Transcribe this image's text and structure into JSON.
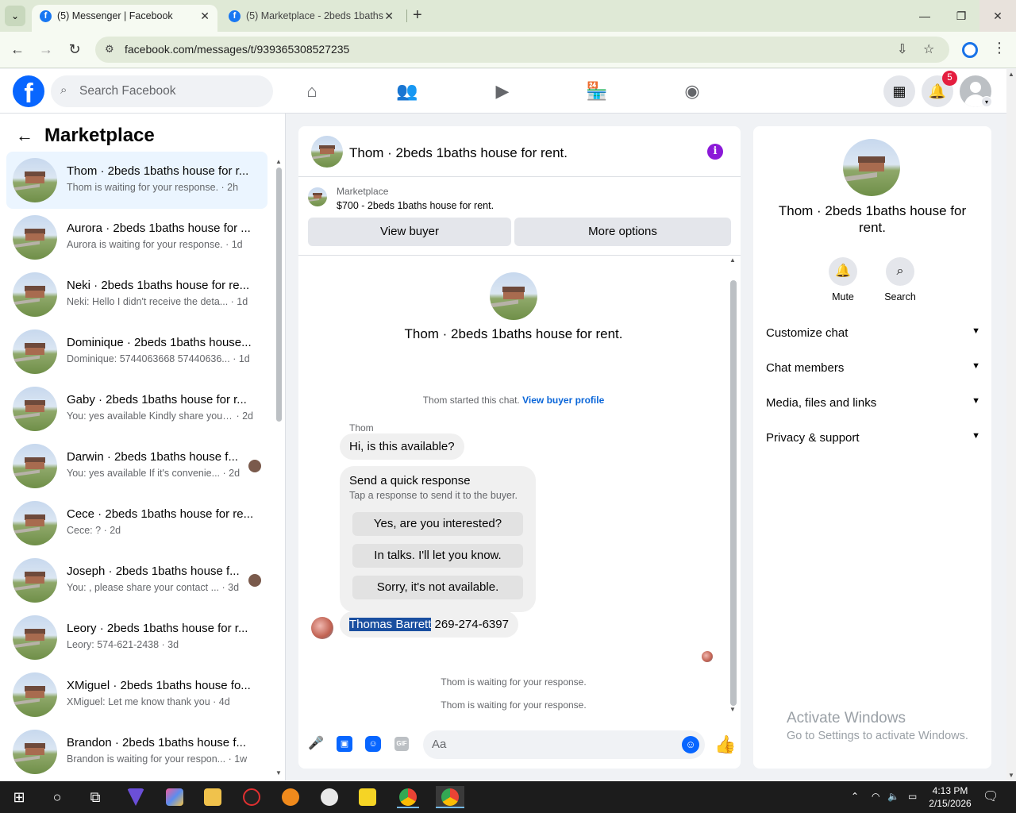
{
  "browser": {
    "tabs": [
      {
        "title": "(5) Messenger | Facebook",
        "active": true
      },
      {
        "title": "(5) Marketplace - 2beds 1baths"
      }
    ],
    "url": "facebook.com/messages/t/939365308527235"
  },
  "fb_header": {
    "search_placeholder": "Search Facebook",
    "notification_count": "5",
    "nav_icons": [
      "home-icon",
      "friends-icon",
      "video-icon",
      "marketplace-icon",
      "groups-icon"
    ]
  },
  "left": {
    "title": "Marketplace",
    "conversations": [
      {
        "name": "Thom · 2beds 1baths house for r...",
        "snippet": "Thom is waiting for your response.",
        "time": "2h",
        "selected": true
      },
      {
        "name": "Aurora · 2beds 1baths house for ...",
        "snippet": "Aurora is waiting for your response.",
        "time": "1d"
      },
      {
        "name": "Neki · 2beds 1baths house for re...",
        "snippet": "Neki: Hello I didn't receive the deta...",
        "time": "1d"
      },
      {
        "name": "Dominique · 2beds 1baths house...",
        "snippet": "Dominique: 5744063668 57440636...",
        "time": "1d"
      },
      {
        "name": "Gaby · 2beds 1baths house for r...",
        "snippet": "You: yes available Kindly share your...",
        "time": "2d"
      },
      {
        "name": "Darwin · 2beds 1baths house f...",
        "snippet": "You: yes available If it's convenie...",
        "time": "2d"
      },
      {
        "name": "Cece · 2beds 1baths house for re...",
        "snippet": "Cece: ?",
        "time": "2d"
      },
      {
        "name": "Joseph · 2beds 1baths house f...",
        "snippet": "You: , please share your contact ...",
        "time": "3d"
      },
      {
        "name": "Leory · 2beds 1baths house for r...",
        "snippet": "Leory: 574-621-2438",
        "time": "3d"
      },
      {
        "name": "XMiguel · 2beds 1baths house fo...",
        "snippet": "XMiguel: Let me know thank you",
        "time": "4d"
      },
      {
        "name": "Brandon · 2beds 1baths house f...",
        "snippet": "Brandon is waiting for your respon...",
        "time": "1w"
      }
    ]
  },
  "chat": {
    "title": "Thom · 2beds 1baths house for rent.",
    "marketplace_label": "Marketplace",
    "listing": "$700 - 2beds 1baths house for rent.",
    "view_buyer": "View buyer",
    "more_options": "More options",
    "intro_name": "Thom · 2beds 1baths house for rent.",
    "started_text": "Thom started this chat.",
    "view_profile": "View buyer profile",
    "sender": "Thom",
    "first_message": "Hi, is this available?",
    "quick_title": "Send a quick response",
    "quick_sub": "Tap a response to send it to the buyer.",
    "quick_responses": [
      "Yes, are you interested?",
      "In talks. I'll let you know.",
      "Sorry, it's not available."
    ],
    "contact_name": "Thomas Barrett",
    "contact_phone": "269-274-6397",
    "waiting_1": "Thom is waiting for your response.",
    "waiting_2": "Thom is waiting for your response.",
    "composer_placeholder": "Aa"
  },
  "right": {
    "name": "Thom · 2beds 1baths house for rent.",
    "mute": "Mute",
    "search": "Search",
    "sections": [
      "Customize chat",
      "Chat members",
      "Media, files and links",
      "Privacy & support"
    ]
  },
  "watermark": {
    "line1": "Activate Windows",
    "line2": "Go to Settings to activate Windows."
  },
  "taskbar": {
    "time": "4:13 PM",
    "date": "2/15/2026"
  }
}
